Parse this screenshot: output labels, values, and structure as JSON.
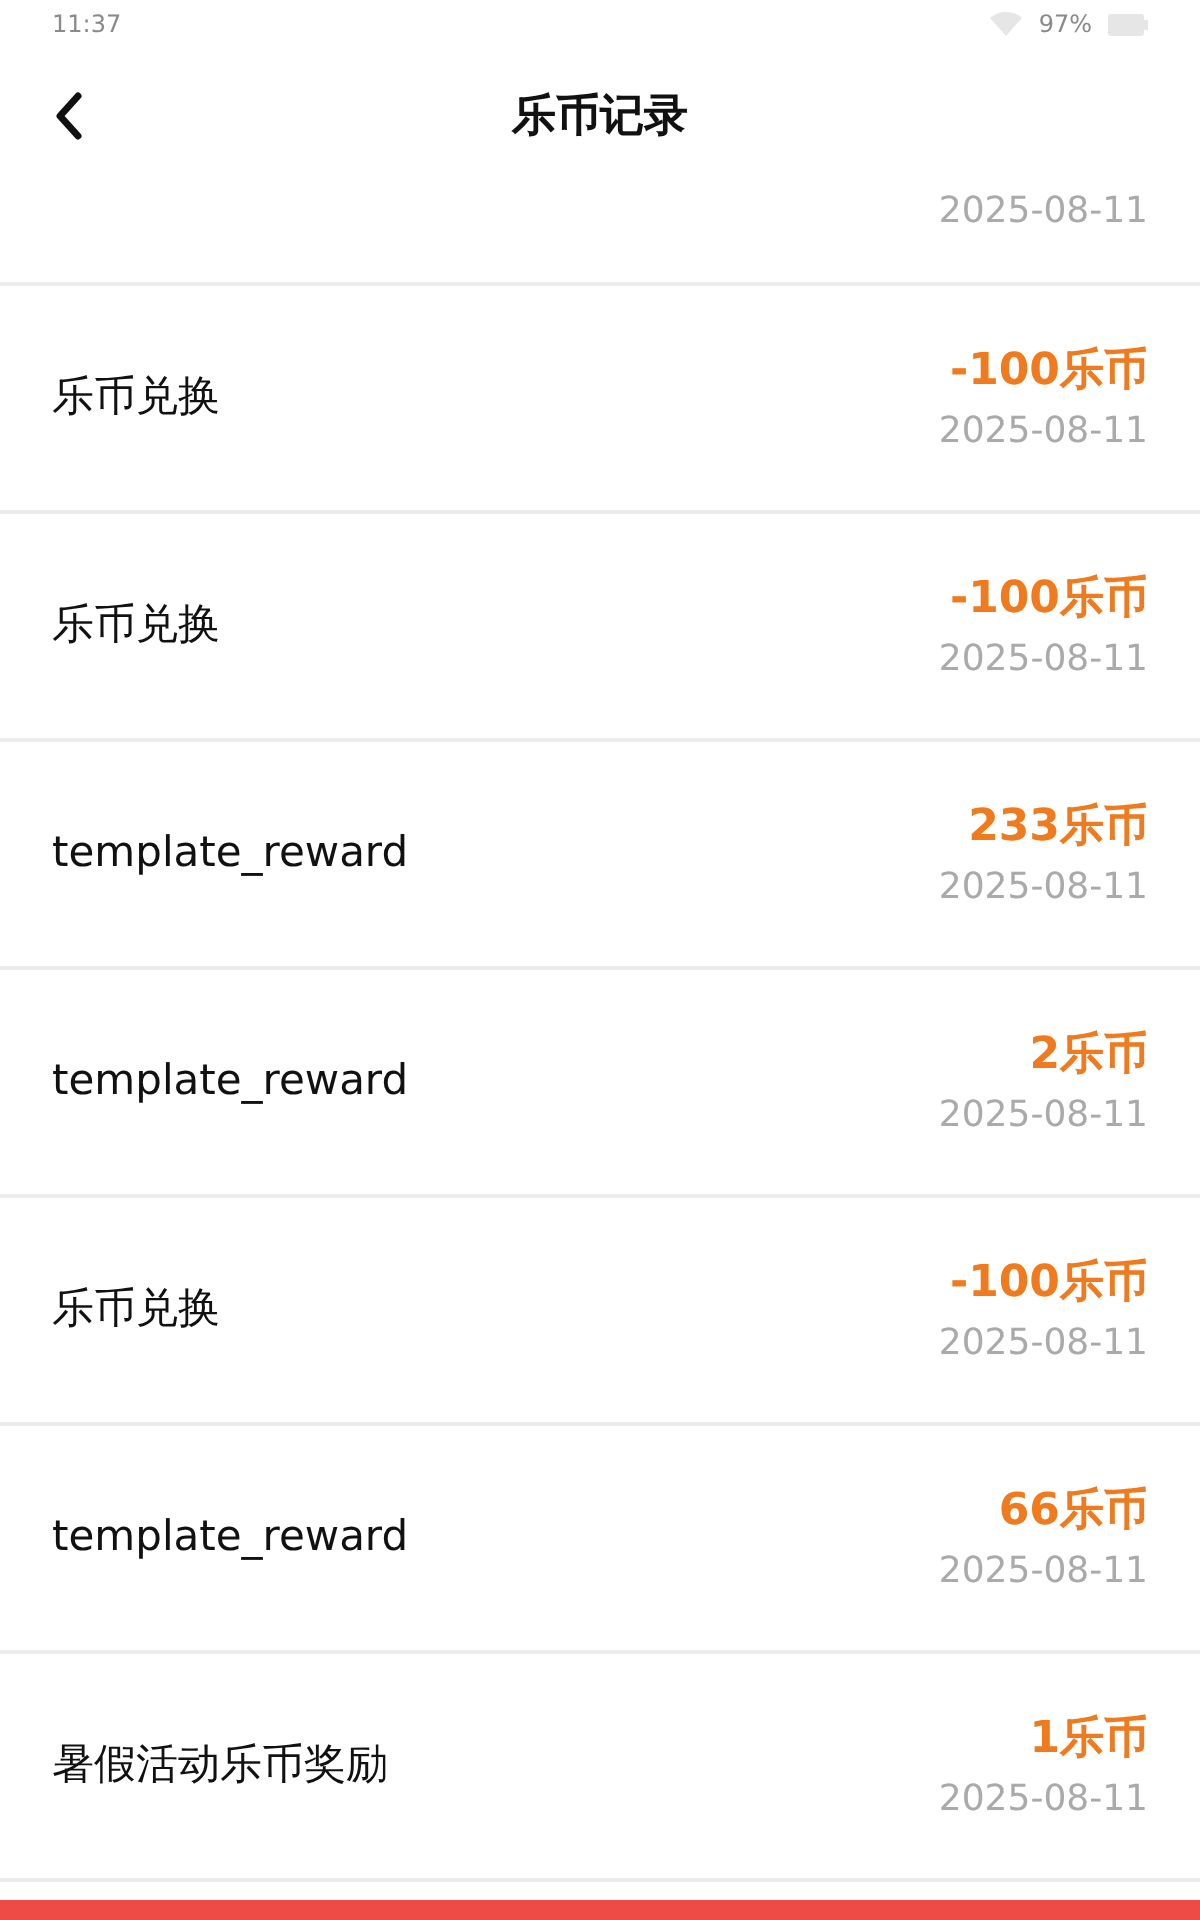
{
  "status_bar": {
    "time": "11:37",
    "battery": "97%"
  },
  "header": {
    "title": "乐币记录"
  },
  "partial_record": {
    "date": "2025-08-11"
  },
  "records": [
    {
      "title": "乐币兑换",
      "amount": "-100乐币",
      "date": "2025-08-11"
    },
    {
      "title": "乐币兑换",
      "amount": "-100乐币",
      "date": "2025-08-11"
    },
    {
      "title": "template_reward",
      "amount": "233乐币",
      "date": "2025-08-11"
    },
    {
      "title": "template_reward",
      "amount": "2乐币",
      "date": "2025-08-11"
    },
    {
      "title": "乐币兑换",
      "amount": "-100乐币",
      "date": "2025-08-11"
    },
    {
      "title": "template_reward",
      "amount": "66乐币",
      "date": "2025-08-11"
    },
    {
      "title": "暑假活动乐币奖励",
      "amount": "1乐币",
      "date": "2025-08-11"
    }
  ]
}
